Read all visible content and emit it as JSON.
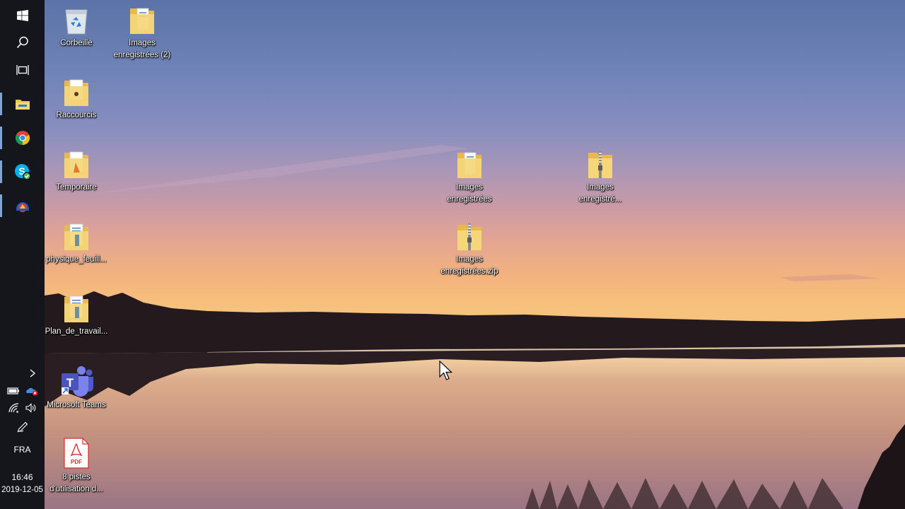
{
  "taskbar": {
    "start_icon": "windows-logo-icon",
    "search_icon": "search-icon",
    "task_view_icon": "task-view-icon",
    "pinned_apps": [
      {
        "name": "File Explorer",
        "icon": "folder-icon"
      },
      {
        "name": "Google Chrome",
        "icon": "chrome-icon"
      },
      {
        "name": "Skype",
        "icon": "skype-icon"
      },
      {
        "name": "App",
        "icon": "app-icon"
      }
    ],
    "tray": {
      "language": "FRA",
      "time": "16:46",
      "date": "2019-12-05"
    }
  },
  "desktop": {
    "icons": [
      {
        "label": "Corbeille",
        "icon": "recycle-bin-icon"
      },
      {
        "label": "Images enregistrées (2)",
        "icon": "folder-icon"
      },
      {
        "label": "Raccourcis",
        "icon": "folder-icon"
      },
      {
        "label": "Temporaire",
        "icon": "folder-icon"
      },
      {
        "label": "physique_feuill...",
        "icon": "folder-icon"
      },
      {
        "label": "Plan_de_travail...",
        "icon": "folder-icon"
      },
      {
        "label": "Microsoft Teams",
        "icon": "teams-icon"
      },
      {
        "label": "8 pistes d'utilisation d...",
        "icon": "pdf-icon"
      },
      {
        "label": "Images enregistrées",
        "icon": "folder-icon"
      },
      {
        "label": "Images enregistré...",
        "icon": "zip-folder-icon"
      },
      {
        "label": "Images enregistrées.zip",
        "icon": "zip-folder-icon"
      }
    ]
  },
  "colors": {
    "taskbar_bg": "#14161b",
    "folder_yellow": "#f3cf6a",
    "sky_top": "#5b73a8",
    "sunset": "#f6c27e"
  }
}
